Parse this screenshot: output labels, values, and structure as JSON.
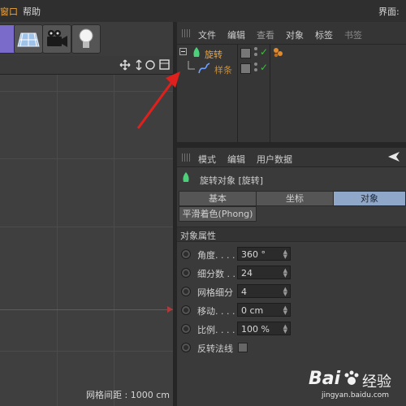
{
  "menubar": {
    "window_label": "窗口",
    "help_label": "帮助",
    "layout_label": "界面:"
  },
  "viewport": {
    "grid_spacing": "网格间距 : 1000 cm",
    "nav_icons": [
      "move-icon",
      "scroll-icon",
      "rotate-icon",
      "maximize-icon"
    ]
  },
  "object_manager": {
    "menu": [
      "文件",
      "编辑",
      "查看",
      "对象",
      "标签",
      "书签"
    ],
    "objects": [
      {
        "name": "旋转",
        "color": "#f2a53a"
      },
      {
        "name": "样条",
        "color": "#c8903a"
      }
    ]
  },
  "attribute_manager": {
    "menu": [
      "模式",
      "编辑",
      "用户数据"
    ],
    "title": "旋转对象 [旋转]",
    "tabs": [
      "基本",
      "坐标",
      "对象"
    ],
    "active_tab": 2,
    "subtab": "平滑着色(Phong)",
    "section": "对象属性",
    "props": [
      {
        "label": "角度. . . .",
        "value": "360 °"
      },
      {
        "label": "细分数 . .",
        "value": "24"
      },
      {
        "label": "网格细分",
        "value": "4"
      },
      {
        "label": "移动. . . .",
        "value": "0 cm"
      },
      {
        "label": "比例. . . .",
        "value": "100 %"
      }
    ],
    "flip_normals_label": "反转法线"
  },
  "watermark": {
    "brand": "Bai",
    "brand2": "经验",
    "url": "jingyan.baidu.com"
  },
  "colors": {
    "accent_orange": "#f2a53a",
    "active_tab": "#8fa8c9",
    "annotation_arrow": "#e0201c",
    "check_green": "#3fbf3f"
  }
}
